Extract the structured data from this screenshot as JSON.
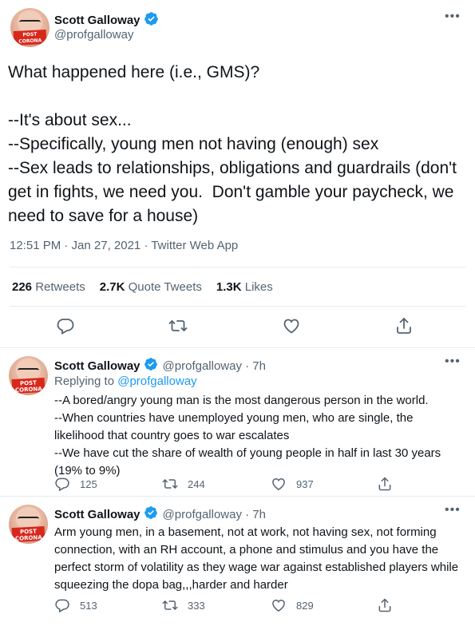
{
  "main_tweet": {
    "display_name": "Scott Galloway",
    "handle": "@profgalloway",
    "text": "What happened here (i.e., GMS)?\n\n--It's about sex...\n--Specifically, young men not having (enough) sex\n--Sex leads to relationships, obligations and guardrails (don't get in fights, we need you.  Don't gamble your paycheck, we need to save for a house)",
    "timestamp": "12:51 PM · Jan 27, 2021 · Twitter Web App",
    "stats": {
      "retweets_count": "226",
      "retweets_label": "Retweets",
      "quotes_count": "2.7K",
      "quotes_label": "Quote Tweets",
      "likes_count": "1.3K",
      "likes_label": "Likes"
    },
    "avatar_text": "POST CORONA"
  },
  "replies": [
    {
      "display_name": "Scott Galloway",
      "handle_time": "@profgalloway · 7h",
      "replying_prefix": "Replying to",
      "replying_handle": "@profgalloway",
      "text": "--A bored/angry young man is the most dangerous person in the world.\n--When countries have unemployed young men, who are single, the likelihood that country goes to war escalates\n--We have cut the share of wealth of young people in half in last 30 years (19% to 9%)",
      "reply_count": "125",
      "retweet_count": "244",
      "like_count": "937"
    },
    {
      "display_name": "Scott Galloway",
      "handle_time": "@profgalloway · 7h",
      "text": "Arm young men, in a basement, not at work, not having sex, not forming connection, with an RH account, a phone and stimulus and you have the perfect storm of volatility as they wage war against established players while squeezing the dopa bag,,,harder and harder",
      "reply_count": "513",
      "retweet_count": "333",
      "like_count": "829"
    }
  ],
  "icons": {
    "verified": "verified-badge-icon",
    "more": "more-dots-icon",
    "reply": "reply-bubble-icon",
    "retweet": "retweet-arrows-icon",
    "like": "heart-icon",
    "share": "share-upload-icon"
  },
  "colors": {
    "accent": "#1d9bf0",
    "text": "#0f1419",
    "secondary": "#536471",
    "border": "#e6ecf0"
  }
}
